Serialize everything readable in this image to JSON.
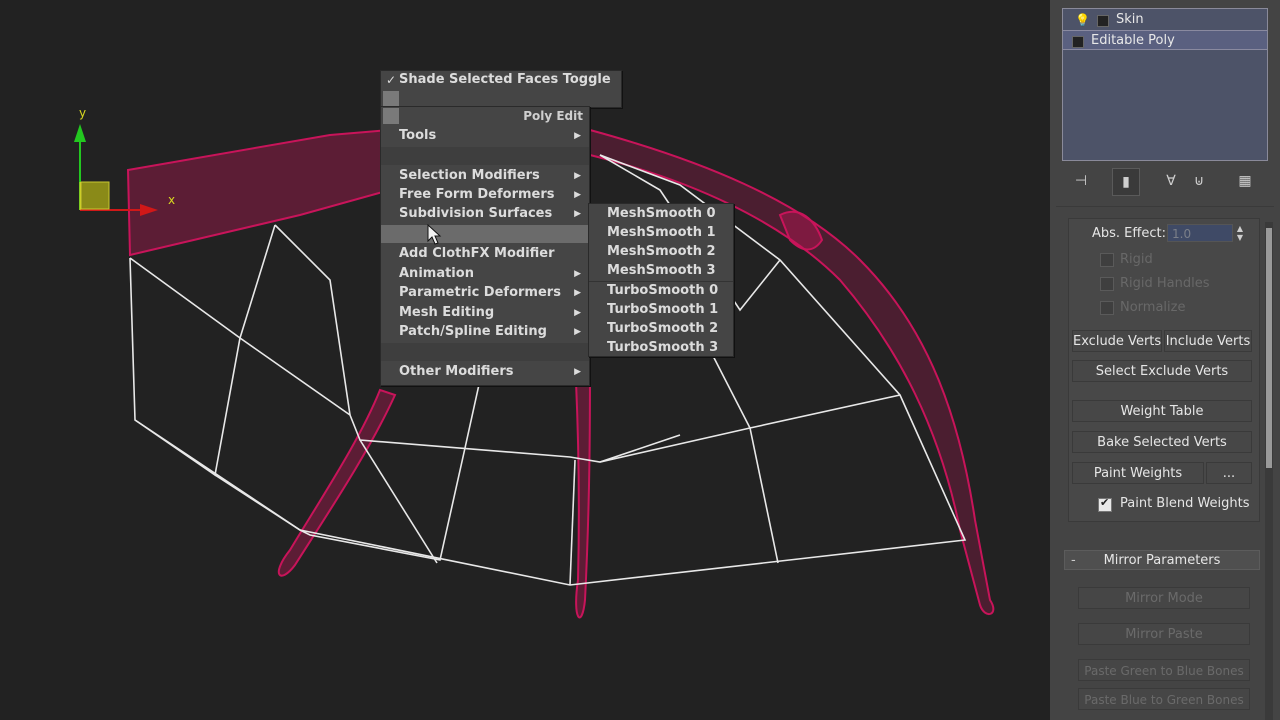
{
  "quad_menu": {
    "toggle_label": "Shade Selected Faces Toggle",
    "section_label": "Poly Edit",
    "items": [
      {
        "label": "Tools",
        "submenu": true
      },
      {
        "label": "Selection Modifiers",
        "submenu": true
      },
      {
        "label": "Free Form Deformers",
        "submenu": true
      },
      {
        "label": "Subdivision Surfaces",
        "submenu": true
      },
      {
        "label": "Add ClothFX Modifier",
        "submenu": false
      },
      {
        "label": "Animation",
        "submenu": true
      },
      {
        "label": "Parametric Deformers",
        "submenu": true
      },
      {
        "label": "Mesh Editing",
        "submenu": true
      },
      {
        "label": "Patch/Spline Editing",
        "submenu": true
      },
      {
        "label": "Other Modifiers",
        "submenu": true
      }
    ],
    "submenu_items": [
      "MeshSmooth 0",
      "MeshSmooth 1",
      "MeshSmooth 2",
      "MeshSmooth 3",
      "TurboSmooth 0",
      "TurboSmooth 1",
      "TurboSmooth 2",
      "TurboSmooth 3"
    ]
  },
  "viewport": {
    "axis_x": "x",
    "axis_y": "y",
    "colors": {
      "background": "#222222",
      "wire_selected": "#c8145a",
      "wire_cage": "#e8e8e8"
    }
  },
  "modifier_stack": {
    "items": [
      "Skin",
      "Editable Poly"
    ]
  },
  "skin_params": {
    "abs_effect_label": "Abs. Effect:",
    "abs_effect_value": "1.0",
    "rigid_label": "Rigid",
    "rigid_handles_label": "Rigid Handles",
    "normalize_label": "Normalize",
    "exclude_verts": "Exclude Verts",
    "include_verts": "Include Verts",
    "select_exclude_verts": "Select Exclude Verts",
    "weight_table": "Weight Table",
    "bake_selected_verts": "Bake Selected Verts",
    "paint_weights": "Paint Weights",
    "paint_options": "...",
    "paint_blend_weights": "Paint Blend Weights"
  },
  "mirror": {
    "header": "Mirror Parameters",
    "collapse": "-",
    "mirror_mode": "Mirror Mode",
    "mirror_paste": "Mirror Paste",
    "paste_green_to_blue": "Paste Green to Blue Bones",
    "paste_blue_to_green": "Paste Blue to Green Bones"
  }
}
